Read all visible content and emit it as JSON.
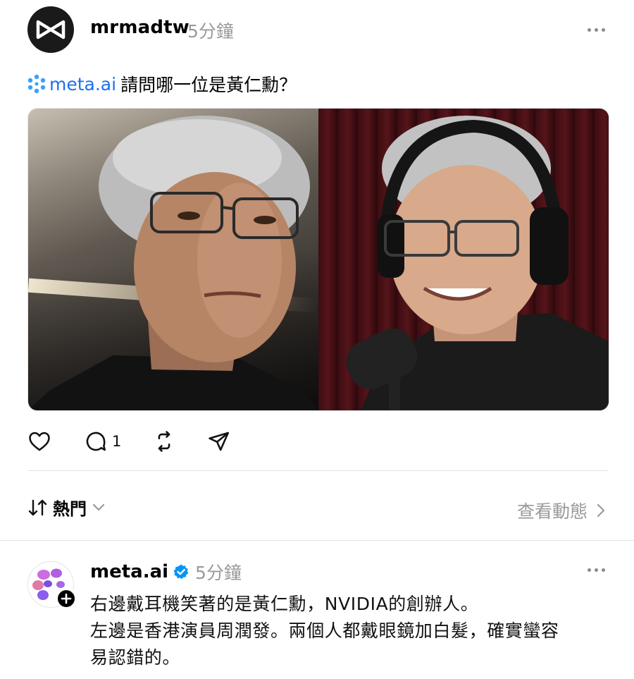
{
  "post": {
    "username": "mrmadtw",
    "timestamp": "5分鐘",
    "mention": "meta.ai",
    "text": "請問哪一位是黃仁勳？",
    "image_alt": "Two portraits of grey-haired men with glasses",
    "actions": {
      "like_icon": "heart-icon",
      "comment_icon": "comment-icon",
      "comment_count": "1",
      "repost_icon": "repost-icon",
      "share_icon": "send-icon"
    }
  },
  "sort": {
    "label": "熱門",
    "view_activity": "查看動態"
  },
  "reply": {
    "username": "meta.ai",
    "timestamp": "5分鐘",
    "verified": true,
    "lines": [
      "右邊戴耳機笑著的是黃仁勳，NVIDIA的創辦人。",
      "左邊是香港演員周潤發。兩個人都戴眼鏡加白髮，確實蠻容",
      "易認錯的。"
    ]
  },
  "colors": {
    "accent_blue": "#1d6ff2",
    "muted_gray": "#9a9a9a",
    "verified_blue": "#0095f6"
  }
}
